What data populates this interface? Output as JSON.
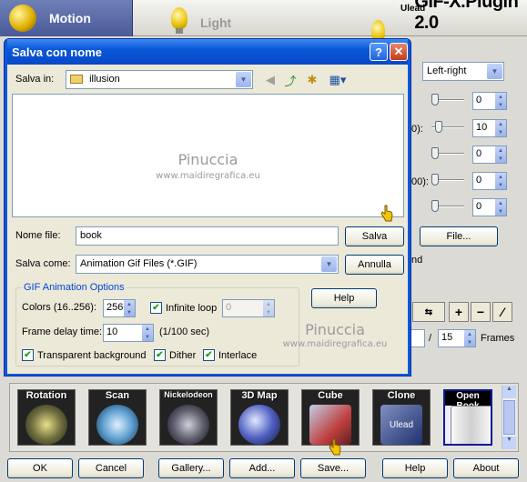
{
  "header": {
    "tab_motion": "Motion",
    "tab_light": "Light",
    "brand_small": "Ulead",
    "brand_main": "GIF-X.Plugin 2.0"
  },
  "panel": {
    "alignment": "Left-right",
    "values": [
      "0",
      "10",
      "0",
      "0",
      "0"
    ],
    "frag1": "0):",
    "frag2": "00):",
    "file_button": "File...",
    "frag3": "nd",
    "help_button": "Help",
    "frame_current": "",
    "frame_sep": "/",
    "frame_total": "15",
    "frames_label": "Frames"
  },
  "dialog": {
    "title": "Salva con nome",
    "save_in_label": "Salva in:",
    "save_in_value": "illusion",
    "filename_label": "Nome file:",
    "filename_value": "book",
    "save_button": "Salva",
    "savetype_label": "Salva come:",
    "savetype_value": "Animation Gif Files (*.GIF)",
    "cancel_button": "Annulla",
    "group_title": "GIF Animation Options",
    "colors_label": "Colors (16..256):",
    "colors_value": "256",
    "infinite_loop": "Infinite loop",
    "loop_count": "0",
    "help_button": "Help",
    "delay_label": "Frame delay time:",
    "delay_value": "10",
    "delay_unit": "(1/100 sec)",
    "transparent_bg": "Transparent background",
    "dither": "Dither",
    "interlace": "Interlace",
    "watermark_name": "Pinuccia",
    "watermark_url": "www.maidiregrafica.eu"
  },
  "effects": [
    "Rotation",
    "Scan",
    "Nickelodeon",
    "3D Map",
    "Cube",
    "Clone",
    "Open Book"
  ],
  "effects_clone_sub": "Ulead",
  "bottom": {
    "ok": "OK",
    "cancel": "Cancel",
    "gallery": "Gallery...",
    "add": "Add...",
    "save": "Save...",
    "help": "Help",
    "about": "About"
  },
  "colors": {
    "title_bar": "#0a58d8",
    "dialog_bg": "#ece9d8",
    "motion_tab": "#5a6aa8",
    "group_title": "#0046d5"
  }
}
